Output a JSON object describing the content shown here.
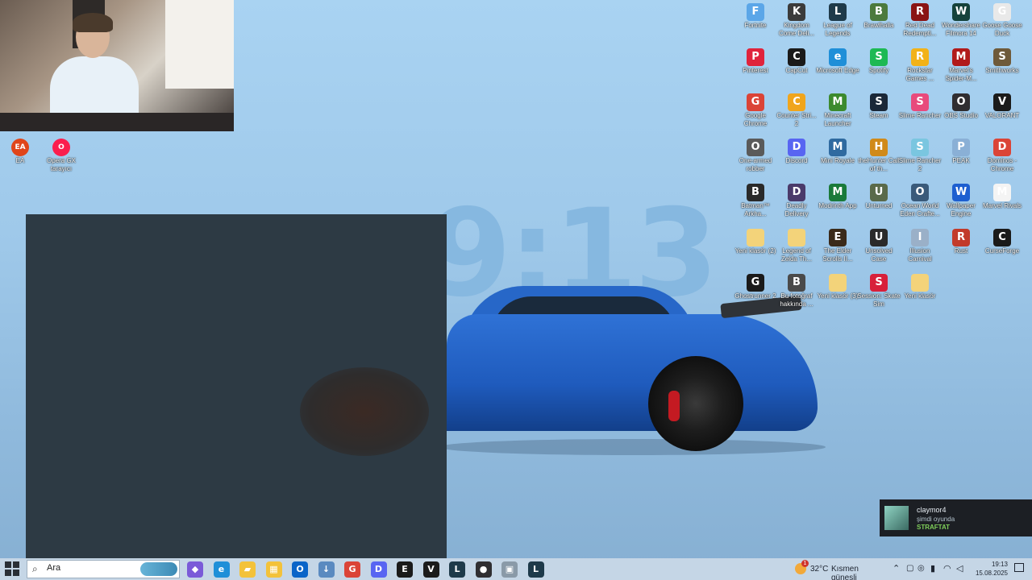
{
  "wallpaper": {
    "number_text": "9:13"
  },
  "desktop_icons_right": [
    {
      "label": "Fortnite",
      "color": "#5ba6e8",
      "glyph": "F"
    },
    {
      "label": "Kingdom Come Deli...",
      "color": "#3b3b3b",
      "glyph": "K"
    },
    {
      "label": "League of Legends",
      "color": "#1e3a4a",
      "glyph": "L"
    },
    {
      "label": "Brawlhalla",
      "color": "#4c7a3d",
      "glyph": "B"
    },
    {
      "label": "Red Dead Redempti...",
      "color": "#8a1414",
      "glyph": "R"
    },
    {
      "label": "Wondershare Filmora 14",
      "color": "#15423b",
      "glyph": "W"
    },
    {
      "label": "Goose Goose Duck",
      "color": "#e9e9e9",
      "glyph": "G"
    },
    {
      "label": "Pinterest",
      "color": "#e0233c",
      "glyph": "P"
    },
    {
      "label": "CapCut",
      "color": "#1a1a1a",
      "glyph": "C"
    },
    {
      "label": "Microsoft Edge",
      "color": "#1f8fd8",
      "glyph": "e"
    },
    {
      "label": "Spotify",
      "color": "#1db954",
      "glyph": "S"
    },
    {
      "label": "Rockstar Games ...",
      "color": "#f2b218",
      "glyph": "R"
    },
    {
      "label": "Marvel's Spider-M...",
      "color": "#b11a1a",
      "glyph": "M"
    },
    {
      "label": "Smithworks",
      "color": "#6e5a3a",
      "glyph": "S"
    },
    {
      "label": "Google Chrome",
      "color": "#db4437",
      "glyph": "G"
    },
    {
      "label": "Counter Stri... 2",
      "color": "#f0a51c",
      "glyph": "C"
    },
    {
      "label": "Minecraft Launcher",
      "color": "#3c8a2e",
      "glyph": "M"
    },
    {
      "label": "Steam",
      "color": "#1b2838",
      "glyph": "S"
    },
    {
      "label": "Slime Rancher",
      "color": "#e84a7c",
      "glyph": "S"
    },
    {
      "label": "OBS Studio",
      "color": "#302e31",
      "glyph": "O"
    },
    {
      "label": "VALORANT",
      "color": "#1b1b1b",
      "glyph": "V"
    },
    {
      "label": "One-armed robber",
      "color": "#5a5a5a",
      "glyph": "O"
    },
    {
      "label": "Discord",
      "color": "#5865f2",
      "glyph": "D"
    },
    {
      "label": "Mini Royale",
      "color": "#2f6aa0",
      "glyph": "M"
    },
    {
      "label": "theHunter Call of th...",
      "color": "#d08a1a",
      "glyph": "H"
    },
    {
      "label": "Slime Rancher 2",
      "color": "#7ac6e0",
      "glyph": "S"
    },
    {
      "label": "PEAK",
      "color": "#8ab0d6",
      "glyph": "P"
    },
    {
      "label": "Dominos - Chrome",
      "color": "#db4437",
      "glyph": "D"
    },
    {
      "label": "Batman™ Arkha...",
      "color": "#2a2a2a",
      "glyph": "B"
    },
    {
      "label": "Deadly Delivery",
      "color": "#4a3a6a",
      "glyph": "D"
    },
    {
      "label": "Modrinth App",
      "color": "#1a7a3a",
      "glyph": "M"
    },
    {
      "label": "Unturned",
      "color": "#5a6a4a",
      "glyph": "U"
    },
    {
      "label": "Ocean World Eden Crafte...",
      "color": "#3a5a7a",
      "glyph": "O"
    },
    {
      "label": "Wallpaper Engine",
      "color": "#1e5fd0",
      "glyph": "W"
    },
    {
      "label": "Marvel Rivals",
      "color": "#f4f4f4",
      "glyph": "M"
    },
    {
      "label": "Yeni klasör (2)",
      "color": "#f3d37a",
      "glyph": " "
    },
    {
      "label": "Legend of Zelda Th...",
      "color": "#f3d37a",
      "glyph": " "
    },
    {
      "label": "The Elder Scrolls II...",
      "color": "#3a2a1a",
      "glyph": "E"
    },
    {
      "label": "Unsolved Case",
      "color": "#2a2a2a",
      "glyph": "U"
    },
    {
      "label": "Illusion Carnival",
      "color": "#9ab0c8",
      "glyph": "I"
    },
    {
      "label": "Rust",
      "color": "#c23a2a",
      "glyph": "R"
    },
    {
      "label": "CurseForge",
      "color": "#1a1a1a",
      "glyph": "C"
    },
    {
      "label": "Ghostrunner 2",
      "color": "#1a1a1a",
      "glyph": "G"
    },
    {
      "label": "Bu fotoğraf hakkında ...",
      "color": "#4a4a4a",
      "glyph": "B"
    },
    {
      "label": "Yeni klasör (3)",
      "color": "#f3d37a",
      "glyph": " "
    },
    {
      "label": "Session: Skate Sim",
      "color": "#d8203a",
      "glyph": "S"
    },
    {
      "label": "Yeni klasör",
      "color": "#f3d37a",
      "glyph": " "
    }
  ],
  "desktop_icons_left": [
    {
      "label": "EA",
      "color": "#e0451a",
      "glyph": "EA"
    },
    {
      "label": "Opera GX tarayıcı",
      "color": "#fa1e4e",
      "glyph": "O"
    }
  ],
  "taskbar": {
    "search_placeholder": "Ara",
    "search_value": "Ara",
    "apps": [
      {
        "name": "copilot-icon",
        "color": "#7a5ad8",
        "glyph": "◆"
      },
      {
        "name": "edge-icon",
        "color": "#1f8fd8",
        "glyph": "e"
      },
      {
        "name": "file-explorer-icon",
        "color": "#f3c23a",
        "glyph": "▰"
      },
      {
        "name": "store-icon",
        "color": "#f3c23a",
        "glyph": "▦"
      },
      {
        "name": "outlook-icon",
        "color": "#0a64c8",
        "glyph": "O"
      },
      {
        "name": "downloads-icon",
        "color": "#5a8ac0",
        "glyph": "↓"
      },
      {
        "name": "chrome-icon",
        "color": "#db4437",
        "glyph": "G"
      },
      {
        "name": "discord-icon",
        "color": "#5865f2",
        "glyph": "D"
      },
      {
        "name": "epic-games-icon",
        "color": "#1a1a1a",
        "glyph": "E"
      },
      {
        "name": "valorant-icon",
        "color": "#1b1b1b",
        "glyph": "V"
      },
      {
        "name": "league-of-legends-icon",
        "color": "#1e3a4a",
        "glyph": "L"
      },
      {
        "name": "obs-icon",
        "color": "#302e31",
        "glyph": "●"
      },
      {
        "name": "app-icon",
        "color": "#8a9aa8",
        "glyph": "▣"
      },
      {
        "name": "riot-client-icon",
        "color": "#1e3a4a",
        "glyph": "L"
      }
    ],
    "weather_temp": "32°C",
    "weather_desc": "Kısmen güneşli",
    "weather_badge": "1",
    "time": "19:13",
    "date": "15.08.2025"
  },
  "notification": {
    "name": "claymor4",
    "status": "şimdi oyunda",
    "game": "STRAFTAT"
  }
}
